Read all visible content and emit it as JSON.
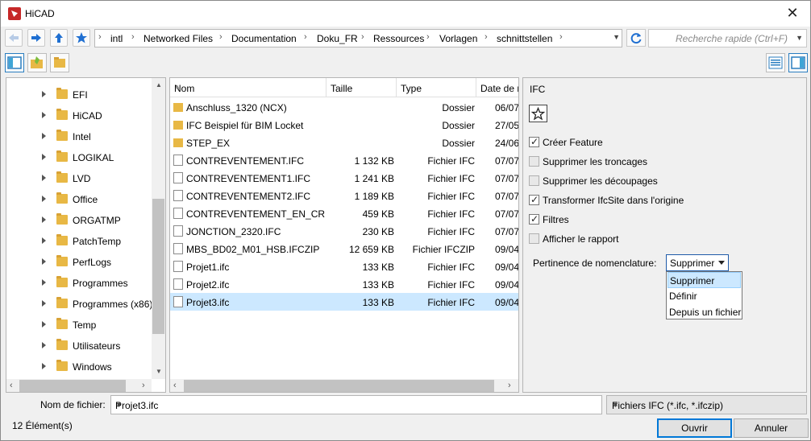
{
  "window": {
    "title": "HiCAD"
  },
  "breadcrumb": [
    "intl",
    "Networked Files",
    "Documentation",
    "Doku_FR",
    "Ressources",
    "Vorlagen",
    "schnittstellen"
  ],
  "search": {
    "placeholder": "Recherche rapide (Ctrl+F)"
  },
  "tree": {
    "items": [
      "EFI",
      "HiCAD",
      "Intel",
      "LOGIKAL",
      "LVD",
      "Office",
      "ORGATMP",
      "PatchTemp",
      "PerfLogs",
      "Programmes",
      "Programmes (x86)",
      "Temp",
      "Utilisateurs",
      "Windows"
    ]
  },
  "files": {
    "columns": [
      "Nom",
      "Taille",
      "Type",
      "Date de m"
    ],
    "rows": [
      {
        "name": "Anschluss_1320 (NCX)",
        "size": "",
        "type": "Dossier",
        "date": "06/07",
        "kind": "folder"
      },
      {
        "name": "IFC Beispiel für BIM Locket",
        "size": "",
        "type": "Dossier",
        "date": "27/05",
        "kind": "folder"
      },
      {
        "name": "STEP_EX",
        "size": "",
        "type": "Dossier",
        "date": "24/06",
        "kind": "folder"
      },
      {
        "name": "CONTREVENTEMENT.IFC",
        "size": "1 132 KB",
        "type": "Fichier IFC",
        "date": "07/07",
        "kind": "file"
      },
      {
        "name": "CONTREVENTEMENT1.IFC",
        "size": "1 241 KB",
        "type": "Fichier IFC",
        "date": "07/07",
        "kind": "file"
      },
      {
        "name": "CONTREVENTEMENT2.IFC",
        "size": "1 189 KB",
        "type": "Fichier IFC",
        "date": "07/07",
        "kind": "file"
      },
      {
        "name": "CONTREVENTEMENT_EN_CRO...",
        "size": "459 KB",
        "type": "Fichier IFC",
        "date": "07/07",
        "kind": "file"
      },
      {
        "name": "JONCTION_2320.IFC",
        "size": "230 KB",
        "type": "Fichier IFC",
        "date": "07/07",
        "kind": "file"
      },
      {
        "name": "MBS_BD02_M01_HSB.IFCZIP",
        "size": "12 659 KB",
        "type": "Fichier IFCZIP",
        "date": "09/04",
        "kind": "file"
      },
      {
        "name": "Projet1.ifc",
        "size": "133 KB",
        "type": "Fichier IFC",
        "date": "09/04",
        "kind": "file"
      },
      {
        "name": "Projet2.ifc",
        "size": "133 KB",
        "type": "Fichier IFC",
        "date": "09/04",
        "kind": "file"
      },
      {
        "name": "Projet3.ifc",
        "size": "133 KB",
        "type": "Fichier IFC",
        "date": "09/04",
        "kind": "file",
        "selected": true
      }
    ]
  },
  "options": {
    "title": "IFC",
    "checkboxes": [
      {
        "label": "Créer Feature",
        "checked": true
      },
      {
        "label": "Supprimer les troncages",
        "checked": false
      },
      {
        "label": "Supprimer les découpages",
        "checked": false
      },
      {
        "label": "Transformer IfcSite dans l'origine",
        "checked": true
      },
      {
        "label": "Filtres",
        "checked": true
      },
      {
        "label": "Afficher le rapport",
        "checked": false
      }
    ],
    "nomenclature_label": "Pertinence de nomenclature:",
    "nomenclature_value": "Supprimer",
    "nomenclature_options": [
      "Supprimer",
      "Définir",
      "Depuis un fichier"
    ]
  },
  "bottom": {
    "filename_label": "Nom de fichier:",
    "filename_value": "Projet3.ifc",
    "filetype_value": "Fichiers IFC (*.ifc, *.ifczip)",
    "count": "12 Élément(s)",
    "open_label": "Ouvrir",
    "cancel_label": "Annuler"
  }
}
